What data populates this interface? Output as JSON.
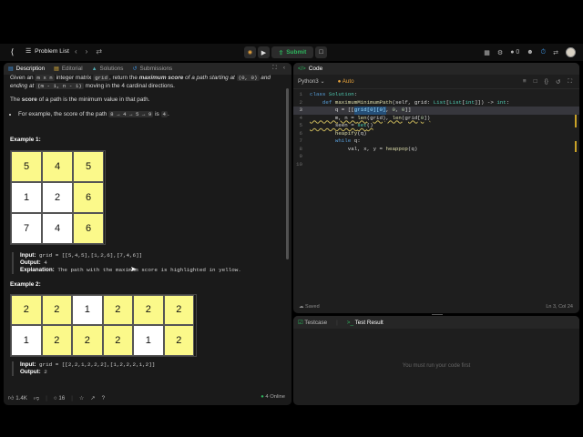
{
  "nav": {
    "problem_list": "Problem List",
    "submit": "Submit",
    "coins": "0"
  },
  "left_tabs": [
    {
      "label": "Description"
    },
    {
      "label": "Editorial"
    },
    {
      "label": "Solutions"
    },
    {
      "label": "Submissions"
    }
  ],
  "description": {
    "intro_1": "Given an",
    "m_n": "m x n",
    "intro_2": "integer matrix",
    "grid": "grid",
    "intro_3": ", return the",
    "intro_em": "maximum score",
    "intro_4": "of a path starting at",
    "start": "(0, 0)",
    "intro_5": "and ending at",
    "end": "(m - 1, n - 1)",
    "intro_6": "moving in the 4 cardinal directions.",
    "score_1": "The",
    "score_b": "score",
    "score_2": "of a path is the minimum value in that path.",
    "bullet_1": "For example, the score of the path",
    "bullet_path": "8 → 4 → 5 → 9",
    "bullet_2": "is",
    "bullet_val": "4",
    "bullet_end": "."
  },
  "example1": {
    "title": "Example 1:",
    "grid": [
      [
        5,
        4,
        5
      ],
      [
        1,
        2,
        6
      ],
      [
        7,
        4,
        6
      ]
    ],
    "highlight": [
      [
        1,
        1,
        1
      ],
      [
        0,
        0,
        1
      ],
      [
        0,
        0,
        1
      ]
    ],
    "input_label": "Input:",
    "input": "grid = [[5,4,5],[1,2,6],[7,4,6]]",
    "output_label": "Output:",
    "output": "4",
    "expl_label": "Explanation:",
    "expl": "The path with the maximum score is highlighted in yellow."
  },
  "example2": {
    "title": "Example 2:",
    "grid": [
      [
        2,
        2,
        1,
        2,
        2,
        2
      ],
      [
        1,
        2,
        2,
        2,
        1,
        2
      ]
    ],
    "highlight": [
      [
        1,
        1,
        0,
        1,
        1,
        1
      ],
      [
        0,
        1,
        1,
        1,
        0,
        1
      ]
    ],
    "input_label": "Input:",
    "input": "grid = [[2,2,1,2,2,2],[1,2,2,2,1,2]]",
    "output_label": "Output:",
    "output": "2"
  },
  "left_footer": {
    "likes": "1.4K",
    "comments": "16",
    "online": "4 Online"
  },
  "code": {
    "tab": "Code",
    "language": "Python3",
    "auto": "Auto",
    "saved": "Saved",
    "cursor_pos": "Ln 3, Col 24",
    "line_numbers": [
      "1",
      "2",
      "3",
      "4",
      "5",
      "6",
      "7",
      "8",
      "9",
      "10"
    ]
  },
  "test": {
    "testcase_tab": "Testcase",
    "result_tab": "Test Result",
    "message": "You must run your code first"
  },
  "colors": {
    "highlight_cell": "#fbf98a",
    "submit_green": "#2db55d",
    "accent_orange": "#e7a23b"
  }
}
